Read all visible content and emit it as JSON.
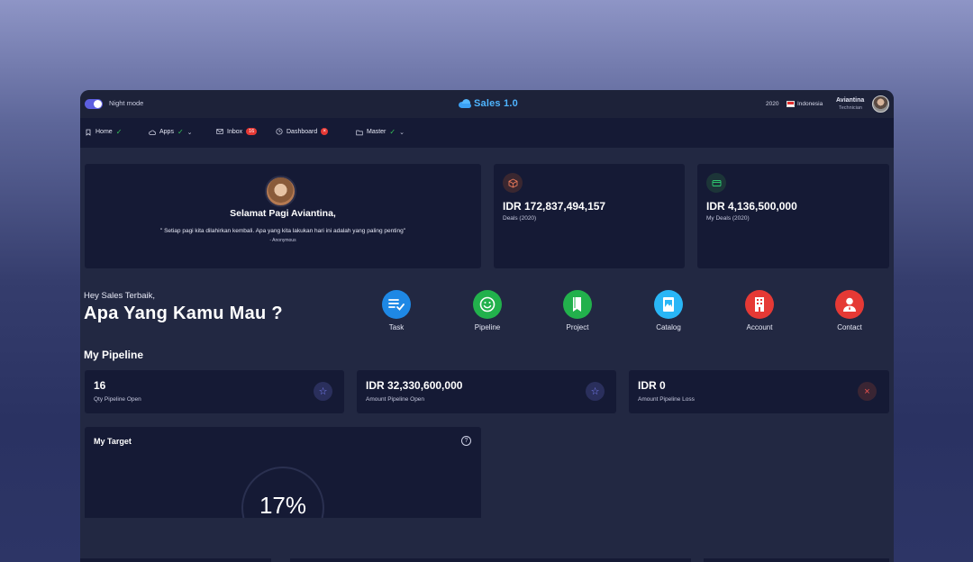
{
  "topbar": {
    "night_mode_label": "Night mode",
    "app_title": "Sales 1.0",
    "year": "2020",
    "country": "Indonesia",
    "user_name": "Aviantina",
    "user_role": "Technician"
  },
  "nav": {
    "items": [
      {
        "label": "Home",
        "icon": "bookmark-icon",
        "status": "check"
      },
      {
        "label": "Apps",
        "icon": "cloud-icon",
        "status": "check",
        "dropdown": true
      },
      {
        "label": "Inbox",
        "icon": "mail-icon",
        "badge": "16"
      },
      {
        "label": "Dashboard",
        "icon": "clock-icon",
        "status": "error"
      },
      {
        "label": "Master",
        "icon": "folder-icon",
        "status": "check",
        "dropdown": true
      }
    ]
  },
  "welcome": {
    "greeting": "Selamat Pagi Aviantina,",
    "quote": "\" Setiap pagi kita dilahirkan kembali. Apa yang kita lakukan hari ini adalah yang paling penting\"",
    "author": "- Anonymous"
  },
  "stats": [
    {
      "value": "IDR 172,837,494,157",
      "label": "Deals (2020)",
      "icon": "box-icon",
      "color": "#e8795a"
    },
    {
      "value": "IDR 4,136,500,000",
      "label": "My Deals (2020)",
      "icon": "card-icon",
      "color": "#2ecc71"
    }
  ],
  "hero": {
    "subtitle": "Hey Sales Terbaik,",
    "title": "Apa Yang Kamu Mau ?"
  },
  "shortcuts": [
    {
      "label": "Task",
      "icon": "task-list-icon",
      "color": "#1e88e5"
    },
    {
      "label": "Pipeline",
      "icon": "smile-icon",
      "color": "#22b14c"
    },
    {
      "label": "Project",
      "icon": "book-icon",
      "color": "#22b14c"
    },
    {
      "label": "Catalog",
      "icon": "catalog-icon",
      "color": "#29b6f6"
    },
    {
      "label": "Account",
      "icon": "building-icon",
      "color": "#e53935"
    },
    {
      "label": "Contact",
      "icon": "person-icon",
      "color": "#e53935"
    }
  ],
  "pipeline": {
    "title": "My Pipeline",
    "cards": [
      {
        "value": "16",
        "label": "Qty Pipeline Open",
        "icon": "star-icon"
      },
      {
        "value": "IDR 32,330,600,000",
        "label": "Amount Pipeline Open",
        "icon": "star-icon"
      },
      {
        "value": "IDR 0",
        "label": "Amount Pipeline Loss",
        "icon": "close-icon"
      }
    ]
  },
  "target": {
    "title": "My Target",
    "percent_label": "17%",
    "progress": 0.17
  },
  "colors": {
    "accent": "#5d5fe0",
    "brand": "#4fb5ff",
    "card_bg": "#151a35",
    "success": "#35c759",
    "danger": "#e53935"
  }
}
